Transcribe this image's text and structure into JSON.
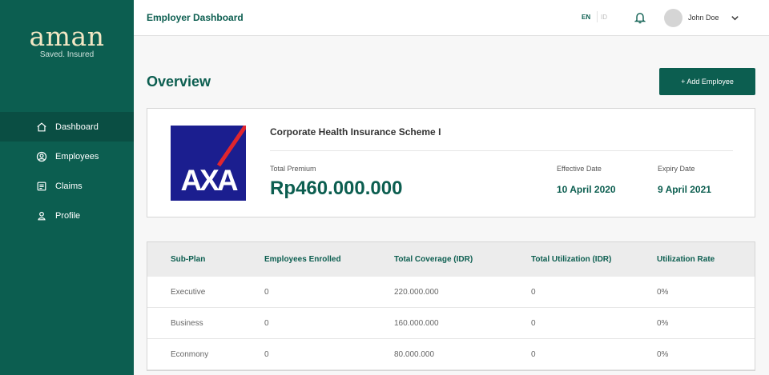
{
  "brand": {
    "name": "aman",
    "tagline": "Saved. Insured"
  },
  "sidebar": {
    "items": [
      {
        "label": "Dashboard",
        "icon": "home-icon",
        "active": true
      },
      {
        "label": "Employees",
        "icon": "user-circle-icon",
        "active": false
      },
      {
        "label": "Claims",
        "icon": "document-icon",
        "active": false
      },
      {
        "label": "Profile",
        "icon": "person-icon",
        "active": false
      }
    ]
  },
  "header": {
    "title": "Employer Dashboard",
    "lang_en": "EN",
    "lang_id": "ID",
    "user_name": "John Doe"
  },
  "main": {
    "title": "Overview",
    "add_button": "+ Add Employee"
  },
  "policy": {
    "insurer_logo_text": "AXA",
    "plan_name": "Corporate Health Insurance Scheme I",
    "premium_label": "Total Premium",
    "premium_value": "Rp460.000.000",
    "effective_label": "Effective Date",
    "effective_value": "10 April 2020",
    "expiry_label": "Expiry Date",
    "expiry_value": "9 April 2021"
  },
  "table": {
    "columns": [
      "Sub-Plan",
      "Employees Enrolled",
      "Total Coverage (IDR)",
      "Total Utilization (IDR)",
      "Utilization Rate"
    ],
    "rows": [
      [
        "Executive",
        "0",
        "220.000.000",
        "0",
        "0%"
      ],
      [
        "Business",
        "0",
        "160.000.000",
        "0",
        "0%"
      ],
      [
        "Econmony",
        "0",
        "80.000.000",
        "0",
        "0%"
      ]
    ]
  },
  "colors": {
    "brand_green": "#0c5e50",
    "sidebar_active": "#0a4e43",
    "logo_cream": "#f3e7c4",
    "axa_blue": "#1b1e8f",
    "axa_red": "#e0262e"
  }
}
